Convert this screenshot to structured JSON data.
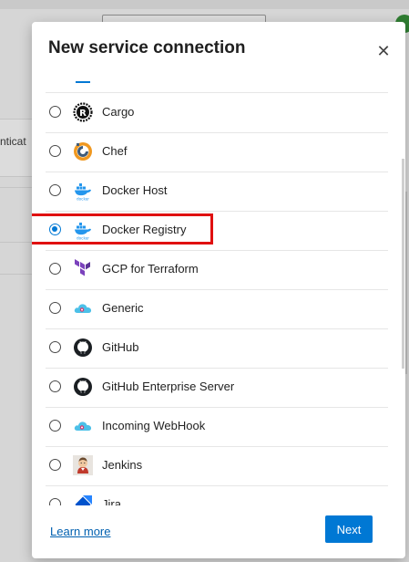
{
  "background": {
    "partial_card_text": "nticat"
  },
  "dialog": {
    "title": "New service connection",
    "close_glyph": "✕",
    "learn_more": "Learn more",
    "next_label": "Next",
    "selected_item": "Docker Registry",
    "accent_color": "#0078d4",
    "highlight_color": "#e01010"
  },
  "items": [
    {
      "label": "Cargo",
      "icon": "rust-cargo-icon",
      "checked": false
    },
    {
      "label": "Chef",
      "icon": "chef-icon",
      "checked": false
    },
    {
      "label": "Docker Host",
      "icon": "docker-icon",
      "checked": false
    },
    {
      "label": "Docker Registry",
      "icon": "docker-icon",
      "checked": true
    },
    {
      "label": "GCP for Terraform",
      "icon": "terraform-icon",
      "checked": false
    },
    {
      "label": "Generic",
      "icon": "cloud-icon",
      "checked": false
    },
    {
      "label": "GitHub",
      "icon": "github-icon",
      "checked": false
    },
    {
      "label": "GitHub Enterprise Server",
      "icon": "github-icon",
      "checked": false
    },
    {
      "label": "Incoming WebHook",
      "icon": "webhook-cloud-icon",
      "checked": false
    },
    {
      "label": "Jenkins",
      "icon": "jenkins-icon",
      "checked": false
    },
    {
      "label": "Jira",
      "icon": "jira-icon",
      "checked": false
    }
  ]
}
